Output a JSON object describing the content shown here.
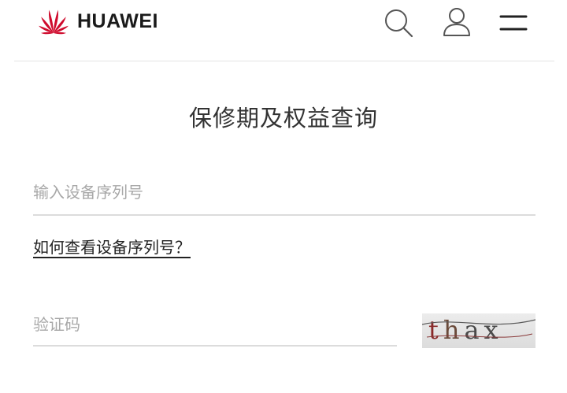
{
  "header": {
    "logo_text": "HUAWEI",
    "brand_color": "#cf0a2c",
    "icons": [
      "search-icon",
      "user-icon",
      "menu-icon"
    ]
  },
  "main": {
    "title": "保修期及权益查询",
    "serial_input": {
      "placeholder": "输入设备序列号",
      "value": ""
    },
    "help_link": "如何查看设备序列号？",
    "captcha_input": {
      "placeholder": "验证码",
      "value": ""
    },
    "captcha_image": {
      "chars": [
        "t",
        "h",
        "a",
        "x"
      ]
    }
  }
}
